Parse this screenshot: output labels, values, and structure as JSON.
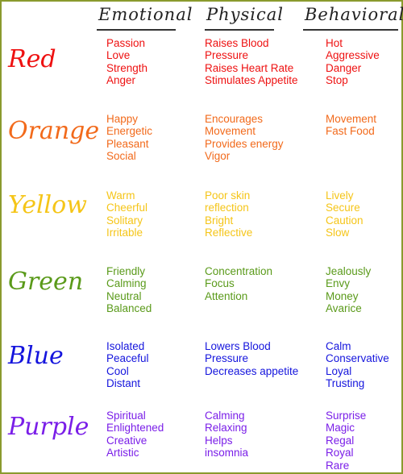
{
  "headers": {
    "emotional": "Emotional",
    "physical": "Physical",
    "behavioral": "Behavioral"
  },
  "rows": [
    {
      "name": "Red",
      "color": "#ee1111",
      "emotional": [
        "Passion",
        "Love",
        "Strength",
        "Anger"
      ],
      "physical": [
        "Raises Blood",
        "Pressure",
        "Raises Heart Rate",
        "Stimulates Appetite"
      ],
      "behavioral": [
        "Hot",
        "Aggressive",
        "Danger",
        "Stop"
      ]
    },
    {
      "name": "Orange",
      "color": "#f26a1b",
      "emotional": [
        "Happy",
        "Energetic",
        "Pleasant",
        "Social"
      ],
      "physical": [
        "Encourages",
        "Movement",
        "Provides energy",
        "Vigor"
      ],
      "behavioral": [
        "Movement",
        "Fast Food"
      ]
    },
    {
      "name": "Yellow",
      "color": "#f5c518",
      "emotional": [
        "Warm",
        "Cheerful",
        "Solitary",
        "Irritable"
      ],
      "physical": [
        "Poor skin",
        "reflection",
        "Bright",
        "Reflective"
      ],
      "behavioral": [
        "Lively",
        "Secure",
        "Caution",
        "Slow"
      ]
    },
    {
      "name": "Green",
      "color": "#5a9a1a",
      "emotional": [
        "Friendly",
        "Calming",
        "Neutral",
        "Balanced"
      ],
      "physical": [
        "Concentration",
        "Focus",
        "Attention"
      ],
      "behavioral": [
        "Jealously",
        "Envy",
        "Money",
        "Avarice"
      ]
    },
    {
      "name": "Blue",
      "color": "#1515dd",
      "emotional": [
        "Isolated",
        "Peaceful",
        "Cool",
        "Distant"
      ],
      "physical": [
        "Lowers Blood",
        "Pressure",
        "Decreases appetite"
      ],
      "behavioral": [
        "Calm",
        "Conservative",
        "Loyal",
        "Trusting"
      ]
    },
    {
      "name": "Purple",
      "color": "#7a1ee8",
      "emotional": [
        "Spiritual",
        "Enlightened",
        "Creative",
        "Artistic"
      ],
      "physical": [
        "Calming",
        "Relaxing",
        "Helps",
        "insomnia"
      ],
      "behavioral": [
        "Surprise",
        "Magic",
        "Regal",
        "Royal",
        "Rare"
      ]
    }
  ]
}
